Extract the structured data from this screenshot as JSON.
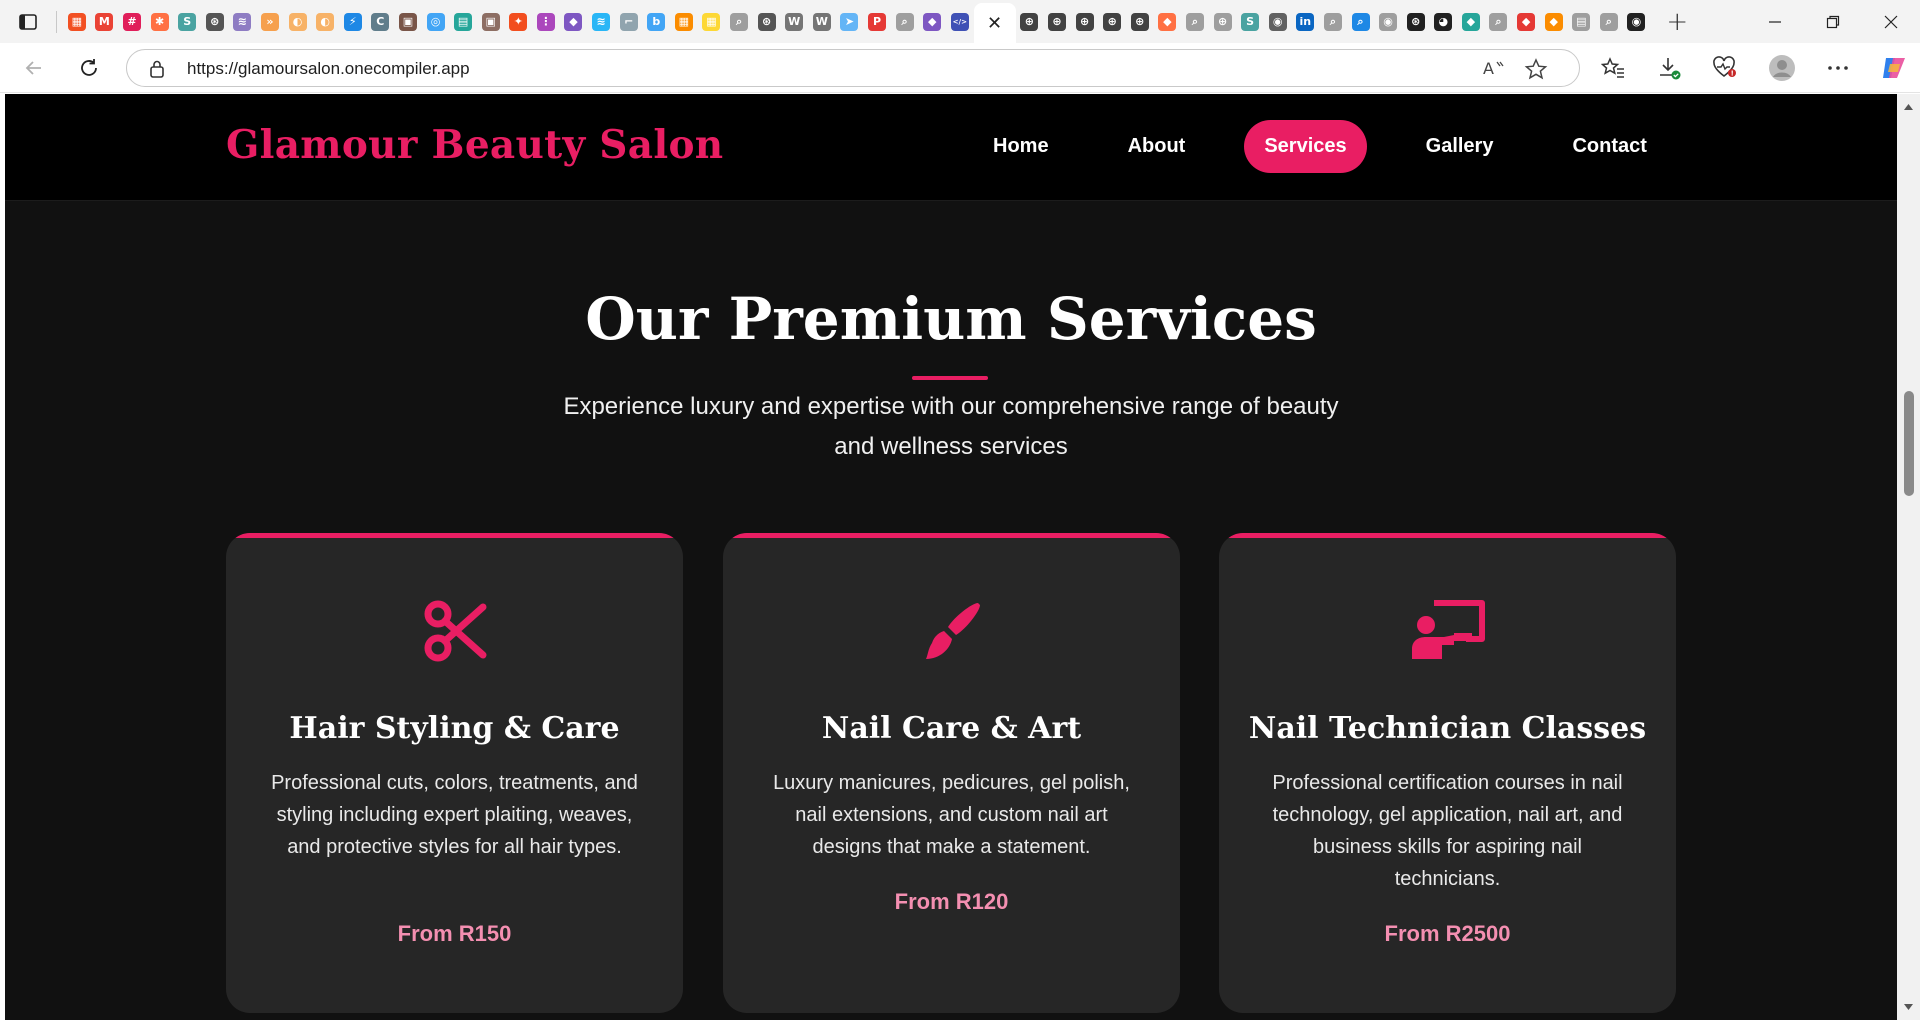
{
  "browser": {
    "url": "https://glamoursalon.onecompiler.app",
    "tab_count_note": "",
    "tabs": [
      {
        "icon": "microsoft-tab-icon",
        "color": "#f25022",
        "glyph": "▦"
      },
      {
        "icon": "gmail-tab-icon",
        "color": "#ea4335",
        "glyph": "M"
      },
      {
        "icon": "slack-tab-icon",
        "color": "#e01e5a",
        "glyph": "#"
      },
      {
        "icon": "burst-tab-icon",
        "color": "#ff7043",
        "glyph": "✱"
      },
      {
        "icon": "s-tab-icon",
        "color": "#4aa3a1",
        "glyph": "S"
      },
      {
        "icon": "openai-tab-icon",
        "color": "#555555",
        "glyph": "⊛"
      },
      {
        "icon": "wave-tab-icon",
        "color": "#8e7cc3",
        "glyph": "≋"
      },
      {
        "icon": "arrows-tab-icon",
        "color": "#f6a04d",
        "glyph": "»"
      },
      {
        "icon": "circle-tab-icon",
        "color": "#f7b267",
        "glyph": "◐"
      },
      {
        "icon": "circle-tab-icon-2",
        "color": "#f7b267",
        "glyph": "◐"
      },
      {
        "icon": "bolt-tab-icon",
        "color": "#1e88e5",
        "glyph": "⚡"
      },
      {
        "icon": "c-tab-icon",
        "color": "#607d8b",
        "glyph": "C"
      },
      {
        "icon": "image-tab-icon",
        "color": "#795548",
        "glyph": "▣"
      },
      {
        "icon": "target-tab-icon",
        "color": "#42a5f5",
        "glyph": "◎"
      },
      {
        "icon": "chat-tab-icon",
        "color": "#26a69a",
        "glyph": "▤"
      },
      {
        "icon": "photo-tab-icon",
        "color": "#8d6e63",
        "glyph": "▣"
      },
      {
        "icon": "figma-tab-icon",
        "color": "#f24e1e",
        "glyph": "✦"
      },
      {
        "icon": "grid-tab-icon",
        "color": "#ab47bc",
        "glyph": "⋮"
      },
      {
        "icon": "copilot-tab-icon",
        "color": "#7e57c2",
        "glyph": "◆"
      },
      {
        "icon": "layers-tab-icon",
        "color": "#29b6f6",
        "glyph": "≋"
      },
      {
        "icon": "chart-tab-icon",
        "color": "#90a4ae",
        "glyph": "⌐"
      },
      {
        "icon": "bing-tab-icon",
        "color": "#42a5f5",
        "glyph": "b"
      },
      {
        "icon": "apps-tab-icon",
        "color": "#fb8c00",
        "glyph": "▦"
      },
      {
        "icon": "apps-tab-icon-2",
        "color": "#fdd835",
        "glyph": "▦"
      },
      {
        "icon": "search-tab-icon",
        "color": "#9e9e9e",
        "glyph": "⌕"
      },
      {
        "icon": "openai-tab-icon-2",
        "color": "#555555",
        "glyph": "⊛"
      },
      {
        "icon": "wiki-tab-icon",
        "color": "#757575",
        "glyph": "W"
      },
      {
        "icon": "wiki-tab-icon-2",
        "color": "#757575",
        "glyph": "W"
      },
      {
        "icon": "send-tab-icon",
        "color": "#64b5f6",
        "glyph": "➤"
      },
      {
        "icon": "pdf-tab-icon",
        "color": "#e53935",
        "glyph": "P"
      },
      {
        "icon": "search-tab-icon-2",
        "color": "#9e9e9e",
        "glyph": "⌕"
      },
      {
        "icon": "copilot-tab-icon-2",
        "color": "#7e57c2",
        "glyph": "◆"
      },
      {
        "icon": "code-tab-icon",
        "color": "#3f51b5",
        "glyph": "</>"
      }
    ],
    "tabs_after": [
      {
        "icon": "globe-tab-icon",
        "color": "#424242",
        "glyph": "⊕"
      },
      {
        "icon": "globe-tab-icon-2",
        "color": "#424242",
        "glyph": "⊕"
      },
      {
        "icon": "globe-tab-icon-3",
        "color": "#424242",
        "glyph": "⊕"
      },
      {
        "icon": "globe-tab-icon-4",
        "color": "#424242",
        "glyph": "⊕"
      },
      {
        "icon": "globe-tab-icon-5",
        "color": "#424242",
        "glyph": "⊕"
      },
      {
        "icon": "flame-tab-icon",
        "color": "#ff7043",
        "glyph": "◆"
      },
      {
        "icon": "search-tab-icon-3",
        "color": "#9e9e9e",
        "glyph": "⌕"
      },
      {
        "icon": "globe-tab-icon-6",
        "color": "#9e9e9e",
        "glyph": "⊕"
      },
      {
        "icon": "s-tab-icon-2",
        "color": "#4aa3a1",
        "glyph": "S"
      },
      {
        "icon": "github-tab-icon",
        "color": "#616161",
        "glyph": "◉"
      },
      {
        "icon": "linkedin-tab-icon",
        "color": "#0a66c2",
        "glyph": "in"
      },
      {
        "icon": "search-tab-icon-4",
        "color": "#9e9e9e",
        "glyph": "⌕"
      },
      {
        "icon": "search-tab-icon-5",
        "color": "#1e88e5",
        "glyph": "⌕"
      },
      {
        "icon": "record-tab-icon",
        "color": "#9e9e9e",
        "glyph": "◉"
      },
      {
        "icon": "openai-tab-icon-3",
        "color": "#212121",
        "glyph": "⊛"
      },
      {
        "icon": "cat-tab-icon",
        "color": "#212121",
        "glyph": "◕"
      },
      {
        "icon": "diamond-tab-icon",
        "color": "#26a69a",
        "glyph": "◆"
      },
      {
        "icon": "search-tab-icon-6",
        "color": "#9e9e9e",
        "glyph": "⌕"
      },
      {
        "icon": "fire-tab-icon",
        "color": "#e53935",
        "glyph": "◆"
      },
      {
        "icon": "fire-tab-icon-2",
        "color": "#fb8c00",
        "glyph": "◆"
      },
      {
        "icon": "doc-tab-icon",
        "color": "#9e9e9e",
        "glyph": "▤"
      },
      {
        "icon": "search-tab-icon-7",
        "color": "#9e9e9e",
        "glyph": "⌕"
      },
      {
        "icon": "github-tab-icon-2",
        "color": "#212121",
        "glyph": "◉"
      }
    ]
  },
  "site": {
    "brand": "Glamour Beauty Salon",
    "nav": [
      "Home",
      "About",
      "Services",
      "Gallery",
      "Contact"
    ],
    "active_nav": "Services",
    "accent_color": "#e91e63",
    "price_color": "#f48fb1"
  },
  "services_section": {
    "title": "Our Premium Services",
    "subtitle": "Experience luxury and expertise with our comprehensive range of beauty and wellness services",
    "cards": [
      {
        "icon": "scissors-icon",
        "title": "Hair Styling & Care",
        "description": "Professional cuts, colors, treatments, and styling including expert plaiting, weaves, and protective styles for all hair types.",
        "price": "From R150"
      },
      {
        "icon": "paintbrush-icon",
        "title": "Nail Care & Art",
        "description": "Luxury manicures, pedicures, gel polish, nail extensions, and custom nail art designs that make a statement.",
        "price": "From R120"
      },
      {
        "icon": "chalkboard-teacher-icon",
        "title": "Nail Technician Classes",
        "description": "Professional certification courses in nail technology, gel application, nail art, and business skills for aspiring nail technicians.",
        "price": "From R2500"
      }
    ]
  }
}
